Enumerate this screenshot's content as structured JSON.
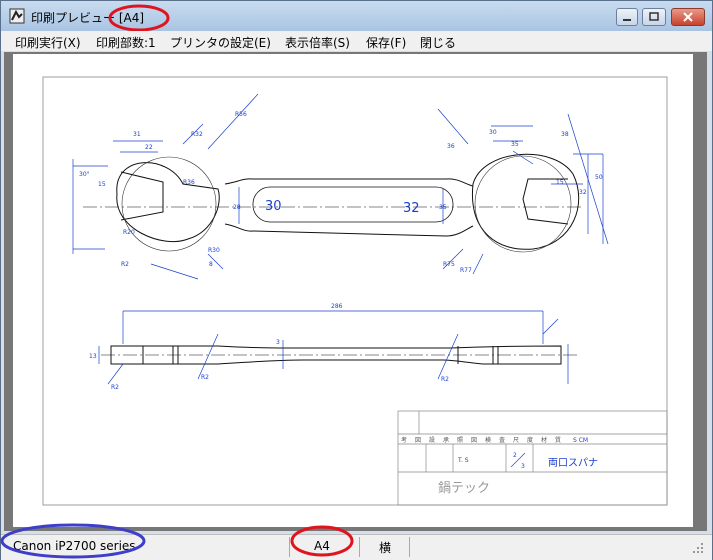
{
  "window": {
    "title": "印刷プレビュー [A4]"
  },
  "menu": {
    "items": [
      {
        "label": "印刷実行(X)"
      },
      {
        "label": "印刷部数:1"
      },
      {
        "label": "プリンタの設定(E)"
      },
      {
        "label": "表示倍率(S)"
      },
      {
        "label": "保存(F)"
      },
      {
        "label": "閉じる"
      }
    ]
  },
  "drawing": {
    "dims": {
      "d31": "31",
      "d22": "22",
      "r32": "R32",
      "r56": "R56",
      "d15": "15",
      "r36": "R36",
      "r20": "R20",
      "r2a": "R2",
      "d28": "28",
      "r30": "R30",
      "d8": "8",
      "d305": "30°",
      "size30": "30",
      "size32": "32",
      "d35": "35",
      "r75": "R75",
      "r77": "R77",
      "d36": "36",
      "d30": "30",
      "d35b": "35",
      "d38": "38",
      "d15b": "15",
      "d32b": "32",
      "d50": "50",
      "d286": "286",
      "d3": "3",
      "d13": "13",
      "r2b": "R2",
      "r2c": "R2",
      "r2d": "R2"
    },
    "title_block": {
      "header_cells": [
        "考",
        "図",
        "設",
        "承",
        "照",
        "図",
        "検",
        "査",
        "尺",
        "度",
        "材",
        "質",
        "S CM"
      ],
      "scale": "T. S",
      "frac_num": "2",
      "frac_den": "3",
      "part_name": "両口スパナ",
      "company": "鍋テック"
    }
  },
  "status": {
    "printer": "Canon iP2700 series",
    "paper": "A4",
    "orientation": "横"
  },
  "annotations": {
    "highlight_red": "#e0141e",
    "highlight_blue": "#3e3fc8",
    "drawing_blue": "#1a3fd0"
  }
}
